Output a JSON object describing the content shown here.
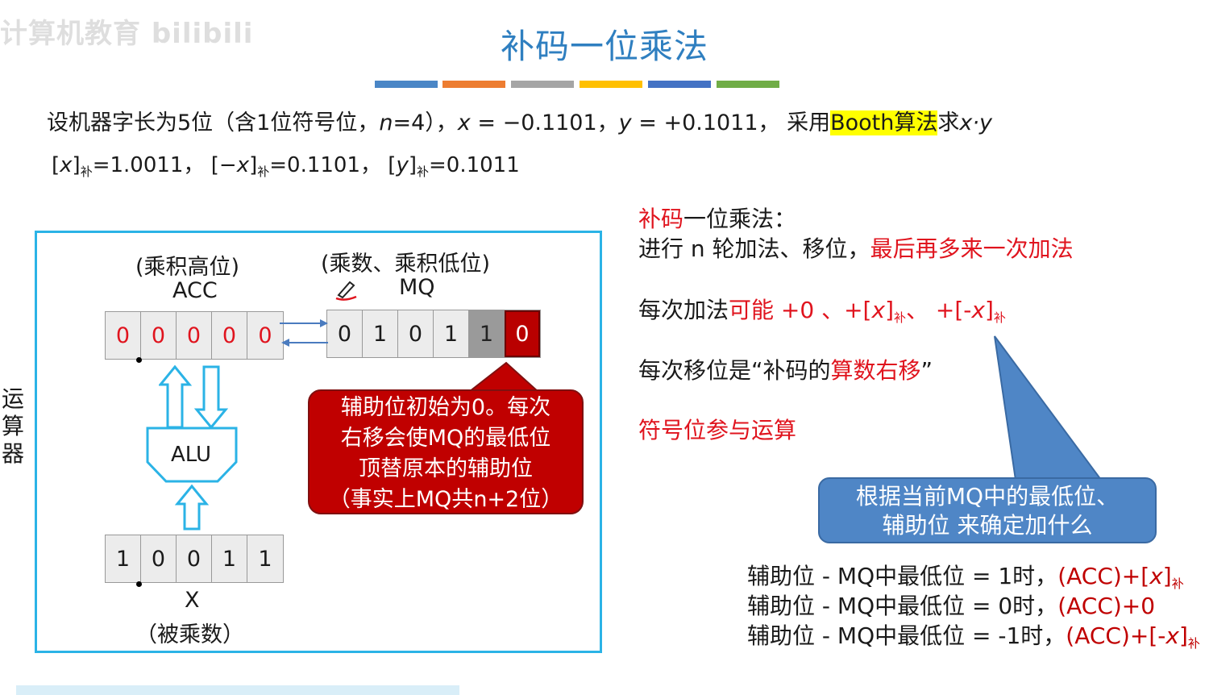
{
  "watermark": "计算机教育 bilibili",
  "title": "补码一位乘法",
  "colors": {
    "accent": "#2f7fc0",
    "bar_colors": [
      "#4a86c6",
      "#ed7d31",
      "#a5a5a5",
      "#ffc000",
      "#4472c4",
      "#70ad47"
    ],
    "red": "#e0141e",
    "callout_red": "#c00000",
    "callout_blue": "#4f86c6",
    "panel_border": "#2bb3e6"
  },
  "problem": {
    "part1": "设机器字长为5位（含1位符号位，",
    "n_var": "n",
    "n_eq": "=4），",
    "x_var": "x",
    "x_eq": " = −0.1101，",
    "y_var": "y",
    "y_eq": " = +0.1011，  采用",
    "booth": "Booth算法",
    "part_end": "求",
    "xy": "x·y"
  },
  "complements": {
    "a_pre": "[",
    "a_var": "x",
    "a_post": "]",
    "sub": "补",
    "a_val": "=1.0011，",
    "b_pre": "[−",
    "b_var": "x",
    "b_post": "]",
    "b_val": "=0.1101，",
    "c_pre": "[",
    "c_var": "y",
    "c_post": "]",
    "c_val": "=0.1011"
  },
  "diagram": {
    "side_label": "运算器",
    "acc_caption": "(乘积高位)",
    "acc_name": "ACC",
    "acc_bits": [
      "0",
      "0",
      "0",
      "0",
      "0"
    ],
    "mq_caption": "(乘数、乘积低位)",
    "mq_name": "MQ",
    "mq_bits": [
      "0",
      "1",
      "0",
      "1",
      "1",
      "0"
    ],
    "alu_label": "ALU",
    "x_bits": [
      "1",
      "0",
      "0",
      "1",
      "1"
    ],
    "x_name": "X",
    "x_caption": "（被乘数）"
  },
  "callout_red": [
    "辅助位初始为0。每次",
    "右移会使MQ的最低位",
    "顶替原本的辅助位",
    "（事实上MQ共n+2位）"
  ],
  "right": {
    "heading_red": "补码",
    "heading_rest": "一位乘法：",
    "line1_a": "进行 n 轮加法、移位，",
    "line1_b": "最后再多来一次加法",
    "line2_a": "每次加法",
    "line2_b": "可能 +0 、+[",
    "line2_x1": "x",
    "line2_c": "]",
    "line2_sub": "补",
    "line2_d": "、 +[-",
    "line2_x2": "x",
    "line2_e": "]",
    "line3_a": "每次移位是“补码的",
    "line3_b": "算数右移",
    "line3_c": "”",
    "line4": "符号位参与运算"
  },
  "callout_blue": [
    "根据当前MQ中的最低位、",
    "辅助位 来确定加什么"
  ],
  "rules": [
    {
      "text": "辅助位 - MQ中最低位 = 1时，",
      "res_pre": "(ACC)+[",
      "res_var": "x",
      "res_post": "]",
      "sub": "补"
    },
    {
      "text": "辅助位 - MQ中最低位 = 0时，",
      "res_pre": "(ACC)+0",
      "res_var": "",
      "res_post": "",
      "sub": ""
    },
    {
      "text": "辅助位 - MQ中最低位 = -1时，",
      "res_pre": "(ACC)+[-",
      "res_var": "x",
      "res_post": "]",
      "sub": "补"
    }
  ]
}
